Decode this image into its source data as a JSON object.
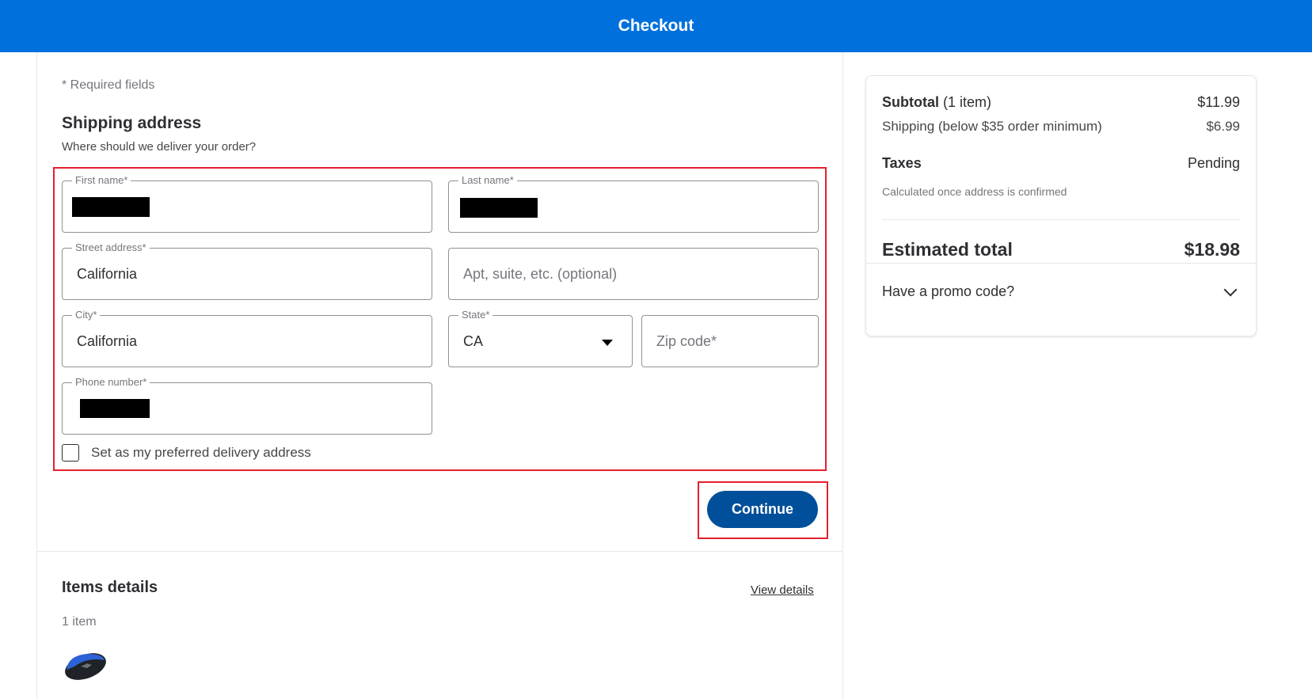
{
  "header": {
    "title": "Checkout"
  },
  "form": {
    "required_note": "* Required fields",
    "title": "Shipping address",
    "subtitle": "Where should we deliver your order?",
    "fields": {
      "first_name": {
        "label": "First name*",
        "value": "[redacted]"
      },
      "last_name": {
        "label": "Last name*",
        "value": "[redacted]"
      },
      "street": {
        "label": "Street address*",
        "value": "California"
      },
      "apt": {
        "placeholder": "Apt, suite, etc. (optional)"
      },
      "city": {
        "label": "City*",
        "value": "California"
      },
      "state": {
        "label": "State*",
        "value": "CA"
      },
      "zip": {
        "placeholder": "Zip code*"
      },
      "phone": {
        "label": "Phone number*",
        "value": "[redacted]"
      }
    },
    "preferred_checkbox": {
      "label": "Set as my preferred delivery address",
      "checked": false
    },
    "continue_label": "Continue"
  },
  "items": {
    "title": "Items details",
    "view_details": "View details",
    "count": "1 item"
  },
  "summary": {
    "subtotal_label": "Subtotal",
    "subtotal_count": "(1 item)",
    "subtotal_value": "$11.99",
    "shipping_label": "Shipping (below $35 order minimum)",
    "shipping_value": "$6.99",
    "taxes_label": "Taxes",
    "taxes_value": "Pending",
    "taxes_note": "Calculated once address is confirmed",
    "total_label": "Estimated total",
    "total_value": "$18.98",
    "promo_label": "Have a promo code?"
  },
  "colors": {
    "brand_blue": "#0071dc",
    "button_blue": "#004f9a",
    "highlight_red": "#e5202e"
  }
}
